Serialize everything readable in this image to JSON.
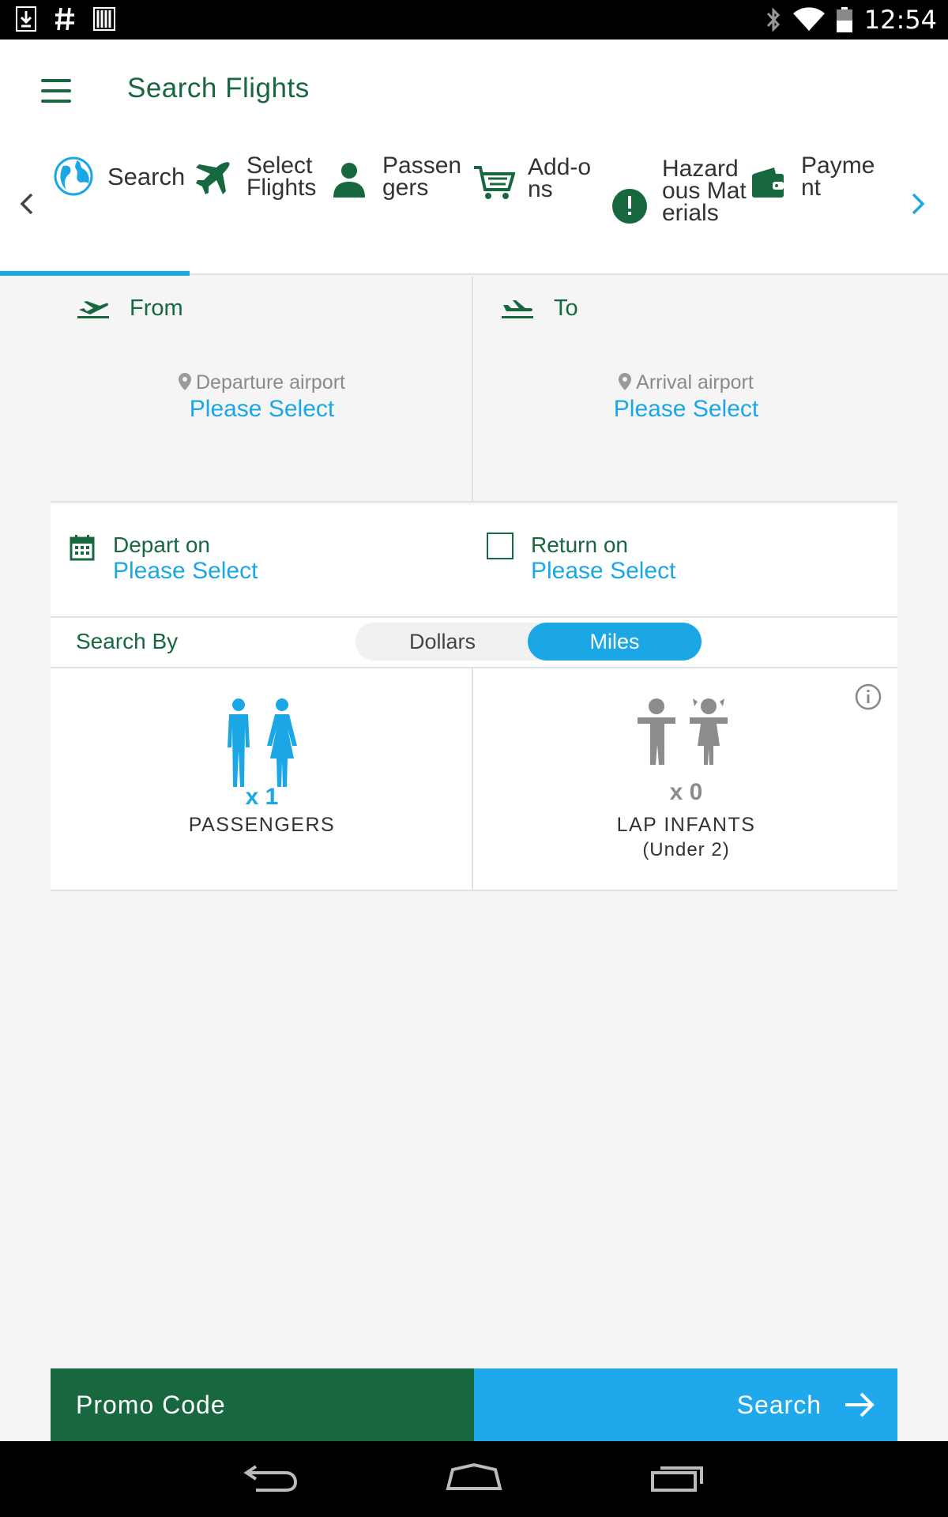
{
  "status_bar": {
    "time": "12:54",
    "icons": [
      "download-icon",
      "hash-icon",
      "barcode-icon",
      "bluetooth-icon",
      "wifi-icon",
      "battery-icon"
    ]
  },
  "app_bar": {
    "title": "Search Flights"
  },
  "steps": [
    {
      "label": "Search",
      "icon": "globe-icon"
    },
    {
      "label": "Select Flights",
      "icon": "plane-icon"
    },
    {
      "label": "Passengers",
      "icon": "person-icon"
    },
    {
      "label": "Add-ons",
      "icon": "cart-icon"
    },
    {
      "label": "Hazardous Materials",
      "icon": "alert-icon"
    },
    {
      "label": "Payment",
      "icon": "wallet-icon"
    }
  ],
  "route": {
    "from": {
      "label": "From",
      "sub": "Departure airport",
      "value": "Please Select"
    },
    "to": {
      "label": "To",
      "sub": "Arrival airport",
      "value": "Please Select"
    }
  },
  "dates": {
    "depart": {
      "label": "Depart on",
      "value": "Please Select"
    },
    "return": {
      "label": "Return on",
      "value": "Please Select",
      "checked": false
    }
  },
  "search_by": {
    "label": "Search By",
    "options": [
      "Dollars",
      "Miles"
    ],
    "selected": "Miles"
  },
  "passengers": {
    "count": "x 1",
    "label": "PASSENGERS"
  },
  "infants": {
    "count": "x 0",
    "label": "LAP INFANTS",
    "sub": "(Under 2)"
  },
  "actions": {
    "promo": "Promo Code",
    "search": "Search"
  },
  "colors": {
    "brand_green": "#17673f",
    "accent_blue": "#1ba7e6",
    "bg": "#f5f5f5"
  }
}
